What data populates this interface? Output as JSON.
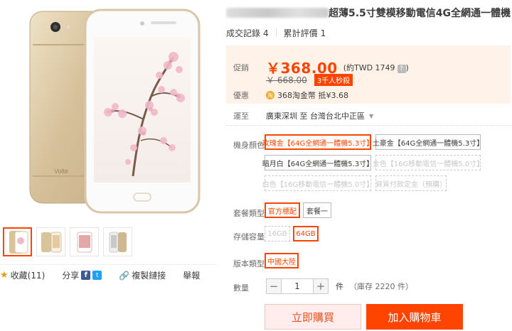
{
  "product": {
    "title": "超薄5.5寸雙模移動電信4G全網通一體機",
    "stats": {
      "sales_label": "成交記錄",
      "sales_count": "4",
      "reviews_label": "累計評價",
      "reviews_count": "1"
    }
  },
  "price": {
    "label": "促銷",
    "current": "￥368.00",
    "approx": "(約TWD 1749",
    "help_icon": "?",
    "approx_close": ")",
    "original": "￥ 668.00",
    "promo_badge": "3千人秒殺"
  },
  "discount": {
    "label": "優惠",
    "coin_icon": "淘",
    "text": "368淘金幣 抵¥3.68"
  },
  "shipping": {
    "label": "運至",
    "destination": "廣東深圳 至 台灣台北中正區"
  },
  "options": {
    "color": {
      "label": "機身顏色",
      "items": [
        "玫瑰金【64G全網通一體機5.3寸】",
        "土豪金【64G全網通一體機5.3寸】",
        "暗月白【64G全網通一體機5.3寸】",
        "金色【16G移動電信一體機5.0寸】",
        "白色【16G移動電信一體機5.0寸】",
        "資質付款定金（預購）"
      ]
    },
    "package": {
      "label": "套餐類型",
      "items": [
        "官方標配",
        "套餐一"
      ]
    },
    "storage": {
      "label": "存儲容量",
      "items": [
        "16GB",
        "64GB"
      ]
    },
    "version": {
      "label": "版本類型",
      "items": [
        "中國大陸"
      ]
    }
  },
  "quantity": {
    "label": "數量",
    "value": "1",
    "minus": "−",
    "plus": "+",
    "unit": "件",
    "stock": "（庫存 2220 件）"
  },
  "actions": {
    "buy_now": "立即購買",
    "add_to_cart": "加入購物車"
  },
  "social": {
    "favorite": "收藏(11)",
    "share": "分享",
    "fb_icon": "f",
    "tw_icon": "t",
    "copy_link": "複製鏈接",
    "report": "舉報"
  },
  "colors": {
    "accent": "#ff4400",
    "price_bg": "#fff2e8",
    "phone_gold": "#d9c39a"
  }
}
